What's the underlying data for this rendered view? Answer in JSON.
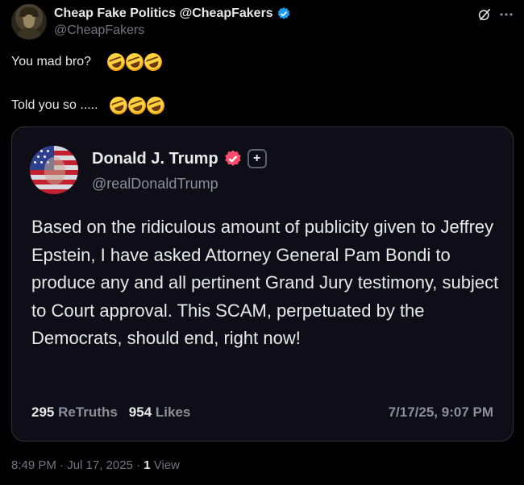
{
  "author": {
    "display_name": "Cheap Fake Politics @CheapFakers",
    "handle": "@CheapFakers"
  },
  "post": {
    "line1": "You mad bro?",
    "line2": "Told you so .....",
    "emoji": "rolling-on-floor-laughing"
  },
  "quote": {
    "name": "Donald J. Trump",
    "handle": "@realDonaldTrump",
    "plus_badge": "+",
    "body": "Based on the ridiculous amount of publicity given to Jeffrey Epstein, I have asked Attorney General Pam Bondi to produce any and all pertinent Grand Jury testimony, subject to Court approval. This SCAM, perpetuated by the Democrats, should end, right now!",
    "retruths_count": "295",
    "retruths_label": "ReTruths",
    "likes_count": "954",
    "likes_label": "Likes",
    "date": "7/17/25, 9:07 PM"
  },
  "footer": {
    "timestamp": "8:49 PM · Jul 17, 2025 · ",
    "views_count": "1",
    "views_label": " View"
  },
  "colors": {
    "background": "#000000",
    "verified": "#1d9bf0",
    "truth_badge": "#ff4d6d"
  }
}
